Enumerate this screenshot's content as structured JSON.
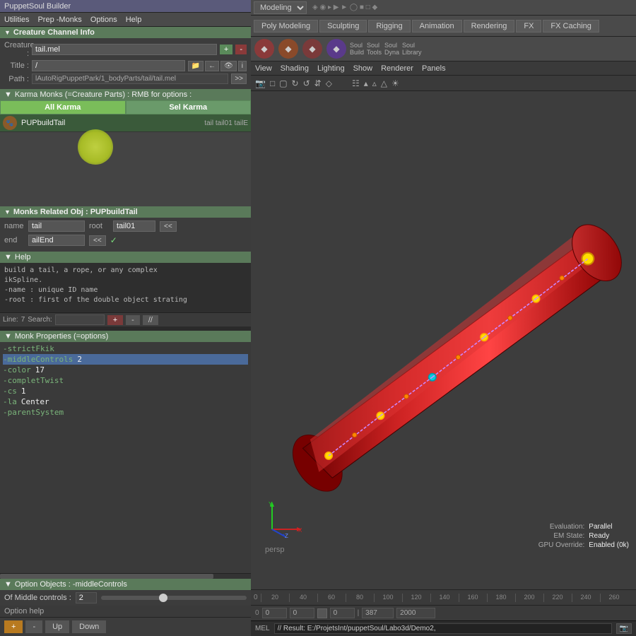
{
  "title_bar": {
    "text": "PuppetSoul Builder"
  },
  "left_menu": {
    "items": [
      "Utilities",
      "Prep -Monks",
      "Options",
      "Help"
    ]
  },
  "creature_channel": {
    "header": "Creature Channel Info",
    "creature_label": "Creature :",
    "creature_value": "tail.mel",
    "btn_plus": "+",
    "btn_minus": "-",
    "title_label": "Title :",
    "title_value": "/",
    "path_label": "Path :",
    "path_value": "lAutoRigPuppetPark/1_bodyParts/tail/tail.mel",
    "btn_arrow": ">>"
  },
  "karma_monks": {
    "header": "Karma Monks (=Creature Parts) : RMB for options :",
    "btn_all": "All Karma",
    "btn_sel": "Sel Karma",
    "items": [
      {
        "name": "PUPbuildTail",
        "tags": "tail   tail01   tailE"
      }
    ]
  },
  "monks_related": {
    "header": "Monks Related Obj : PUPbuildTail",
    "name_label": "name",
    "name_value": "tail",
    "root_label": "root",
    "root_value": "tail01",
    "btn_root_nav": "<<",
    "end_label": "end",
    "end_value": "ailEnd",
    "btn_end_nav": "<<"
  },
  "help": {
    "header": "Help",
    "text": "build a tail, a rope, or any complex\nikSpline.\n-name : unique ID name\n-root : first of the double object strating",
    "line_label": "Line:",
    "line_num": "7",
    "search_label": "Search:",
    "search_value": "",
    "btn_plus": "+",
    "btn_minus": "-",
    "btn_slash": "//"
  },
  "monk_properties": {
    "header": "Monk Properties (=options)",
    "items": [
      {
        "key": "-strictFkik",
        "value": ""
      },
      {
        "key": "-middleControls",
        "value": "2",
        "selected": true
      },
      {
        "key": "-color",
        "value": "17"
      },
      {
        "key": "-completTwist",
        "value": ""
      },
      {
        "key": "-cs",
        "value": "1"
      },
      {
        "key": "-la",
        "value": "Center"
      },
      {
        "key": "-parentSystem",
        "value": ""
      }
    ]
  },
  "option_objects": {
    "header": "Option Objects : -middleControls",
    "label": "Of Middle controls :",
    "value": "2"
  },
  "option_help": {
    "text": "Option help"
  },
  "bottom_buttons": {
    "btn_orange": "+",
    "btn_minus": "-",
    "btn_up": "Up",
    "btn_down": "Down"
  },
  "viewport": {
    "menu_items": [
      "View",
      "Shading",
      "Lighting",
      "Show",
      "Renderer",
      "Panels"
    ],
    "tabs": [
      "Poly Modeling",
      "Sculpting",
      "Rigging",
      "Animation",
      "Rendering",
      "FX",
      "FX Caching"
    ],
    "soul_buttons": [
      "Soul\nBuild",
      "Soul\nTools",
      "Soul\nDyna",
      "Soul\nLibrary"
    ],
    "persp_label": "persp",
    "eval_label": "Evaluation:",
    "eval_value": "Parallel",
    "em_label": "EM State:",
    "em_value": "Ready",
    "gpu_label": "GPU Override:",
    "gpu_value": "Enabled (0k)"
  },
  "timeline": {
    "marks": [
      "0",
      "20",
      "40",
      "60",
      "80",
      "100",
      "120",
      "140",
      "160",
      "180",
      "200",
      "220",
      "240",
      "260"
    ],
    "start": "0",
    "values": [
      "0",
      "0",
      "0",
      "387",
      "2000"
    ]
  },
  "mel_bar": {
    "label": "MEL",
    "result": "// Result: E:/ProjetsInt/puppetSoul/Labo3d/Demo2,"
  },
  "modeling_dropdown": "Modeling"
}
